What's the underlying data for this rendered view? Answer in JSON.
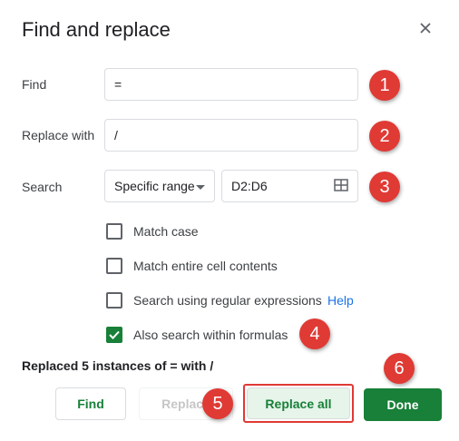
{
  "dialog": {
    "title": "Find and replace",
    "close_icon": "close-icon"
  },
  "find": {
    "label": "Find",
    "value": "="
  },
  "replace": {
    "label": "Replace with",
    "value": "/"
  },
  "search": {
    "label": "Search",
    "scope": "Specific range",
    "range": "D2:D6",
    "grid_icon": "grid-icon"
  },
  "options": [
    {
      "label": "Match case",
      "checked": false
    },
    {
      "label": "Match entire cell contents",
      "checked": false
    },
    {
      "label": "Search using regular expressions",
      "checked": false
    },
    {
      "label": "Also search within formulas",
      "checked": true
    }
  ],
  "help_link": "Help",
  "status": "Replaced 5 instances of = with /",
  "buttons": {
    "find": "Find",
    "replace": "Replace",
    "replace_all": "Replace all",
    "done": "Done"
  },
  "annotations": [
    "1",
    "2",
    "3",
    "4",
    "5",
    "6"
  ],
  "colors": {
    "accent": "#188038",
    "annotation": "#e03a35",
    "link": "#1a73e8"
  }
}
